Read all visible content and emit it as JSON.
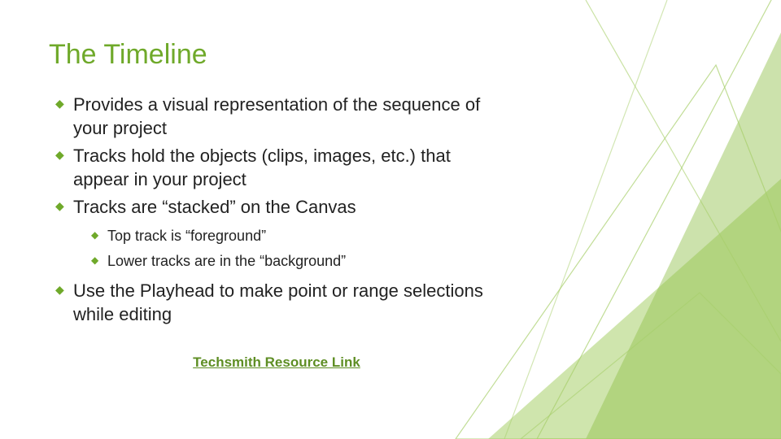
{
  "title": "The Timeline",
  "bullets": [
    {
      "text": "Provides a visual representation of the sequence of your project"
    },
    {
      "text": "Tracks hold the objects (clips, images, etc.) that appear in your project"
    },
    {
      "text": "Tracks are “stacked” on the Canvas",
      "sub": [
        "Top track is “foreground”",
        "Lower tracks are in the “background”"
      ]
    },
    {
      "text": "Use the Playhead to make point or range selections while editing"
    }
  ],
  "link": {
    "label": "Techsmith Resource Link"
  },
  "colors": {
    "accent": "#6fa92a",
    "link": "#5e8e24",
    "bg_light": "#a7cf6a",
    "bg_mid": "#8fbf47"
  }
}
